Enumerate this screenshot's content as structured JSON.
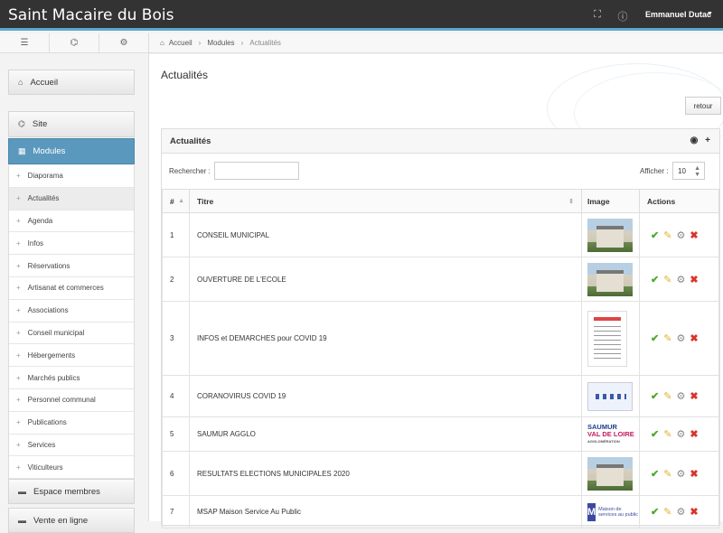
{
  "header": {
    "site_title": "Saint Macaire du Bois",
    "user_name": "Emmanuel Dutac",
    "icons": [
      "fullscreen-icon",
      "info-icon",
      "caret-down-icon"
    ]
  },
  "sidebar": {
    "tab_icons": [
      "menu-icon",
      "sitemap-icon",
      "cogs-icon"
    ],
    "accueil": "Accueil",
    "site": "Site",
    "modules": "Modules",
    "items": [
      "Diaporama",
      "Actualités",
      "Agenda",
      "Infos",
      "Réservations",
      "Artisanat et commerces",
      "Associations",
      "Conseil municipal",
      "Hébergements",
      "Marchés publics",
      "Personnel communal",
      "Publications",
      "Services",
      "Viticulteurs"
    ],
    "espace_membres": "Espace membres",
    "vente_en_ligne": "Vente en ligne"
  },
  "breadcrumb": {
    "home": "Accueil",
    "modules": "Modules",
    "current": "Actualités"
  },
  "main": {
    "page_title": "Actualités",
    "back_button": "retour",
    "panel_title": "Actualités",
    "search_label": "Rechercher :",
    "search_value": "",
    "show_label": "Afficher :",
    "show_value": "10",
    "columns": [
      "#",
      "Titre",
      "Image",
      "Actions"
    ],
    "rows": [
      {
        "num": "1",
        "title": "CONSEIL MUNICIPAL",
        "image": "mairie-photo"
      },
      {
        "num": "2",
        "title": "OUVERTURE DE L'ECOLE",
        "image": "ecole-photo"
      },
      {
        "num": "3",
        "title": "INFOS et DEMARCHES pour COVID 19",
        "image": "attestation-document"
      },
      {
        "num": "4",
        "title": "CORANOVIRUS COVID 19",
        "image": "covid-poster"
      },
      {
        "num": "5",
        "title": "SAUMUR AGGLO",
        "image": "saumur-logo"
      },
      {
        "num": "6",
        "title": "RESULTATS ELECTIONS MUNICIPALES 2020",
        "image": "mairie-photo"
      },
      {
        "num": "7",
        "title": "MSAP Maison Service Au Public",
        "image": "msap-logo"
      }
    ],
    "logo_text": {
      "saumur": "SAUMUR",
      "val": "VAL DE LOIRE",
      "agglo": "AGGLOMÉRATION",
      "msap": "M",
      "msap_sub": "Maison de services au public"
    }
  },
  "colors": {
    "topbar": "#333333",
    "accent": "#5b98bd",
    "validate": "#4ca82e",
    "edit": "#e2b32a",
    "delete": "#d9342b"
  }
}
